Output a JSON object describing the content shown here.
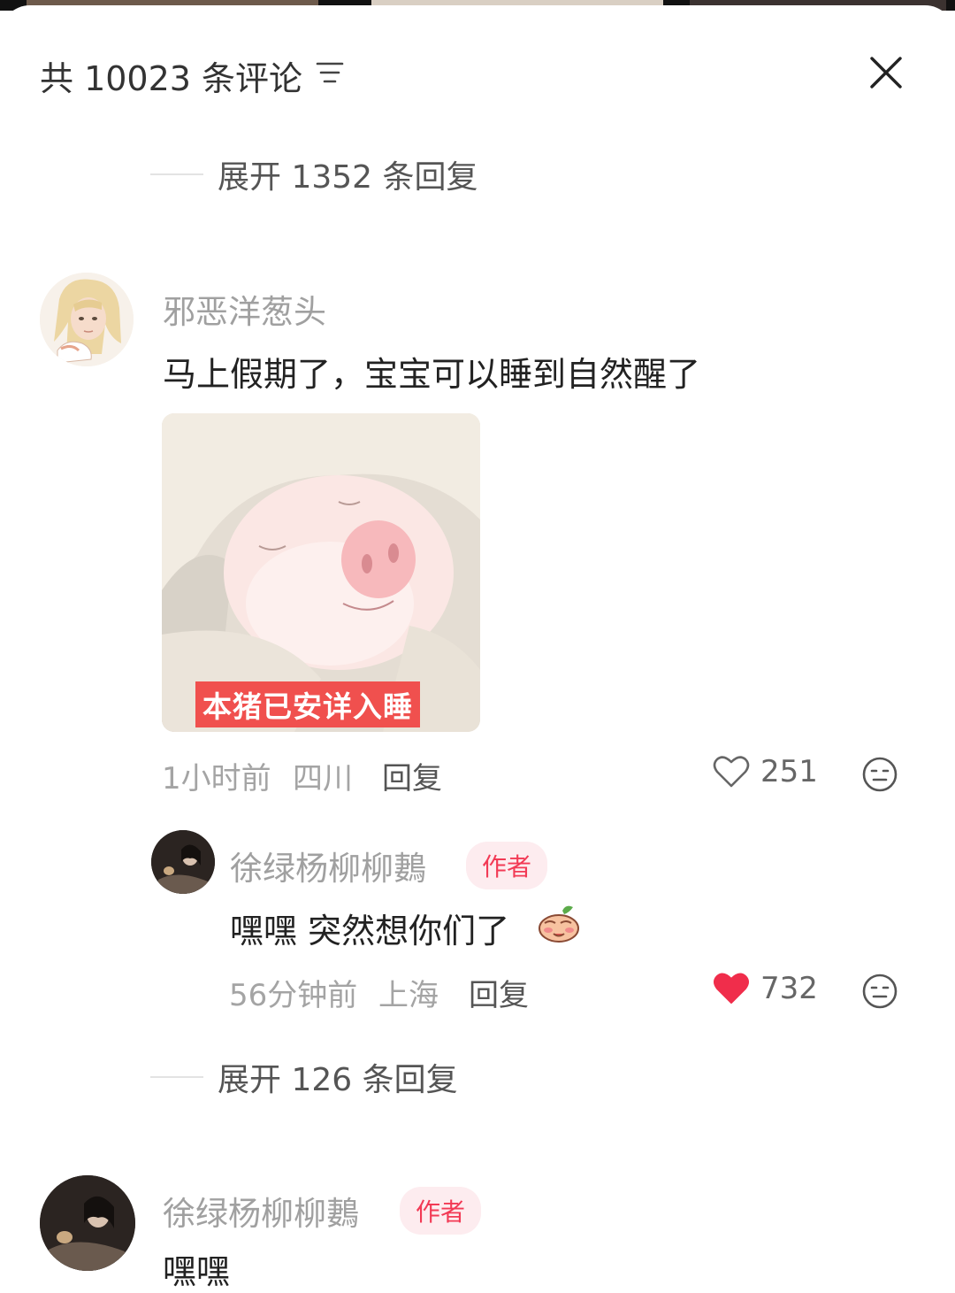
{
  "header": {
    "title": "共 10023 条评论",
    "sort_icon": "sort-lines-icon",
    "close_icon": "close-icon"
  },
  "expand_top": {
    "label": "展开 1352 条回复"
  },
  "comment1": {
    "username": "邪恶洋葱头",
    "text": "马上假期了，宝宝可以睡到自然醒了",
    "image_caption": "本猪已安详入睡",
    "time": "1小时前",
    "location": "四川",
    "reply_label": "回复",
    "likes": "251",
    "liked": false
  },
  "reply1": {
    "username": "徐绿杨柳柳鶈",
    "badge": "作者",
    "text": "嘿嘿 突然想你们了",
    "emoji": "shy-sticker-icon",
    "time": "56分钟前",
    "location": "上海",
    "reply_label": "回复",
    "likes": "732",
    "liked": true
  },
  "expand_bottom": {
    "label": "展开 126 条回复"
  },
  "comment2": {
    "username": "徐绿杨柳柳鶈",
    "badge": "作者",
    "text": "嘿嘿"
  },
  "colors": {
    "liked_heart": "#f02d4b",
    "author_badge_bg": "#fdecef",
    "author_badge_text": "#f23a55",
    "caption_bg": "#f0504e"
  }
}
